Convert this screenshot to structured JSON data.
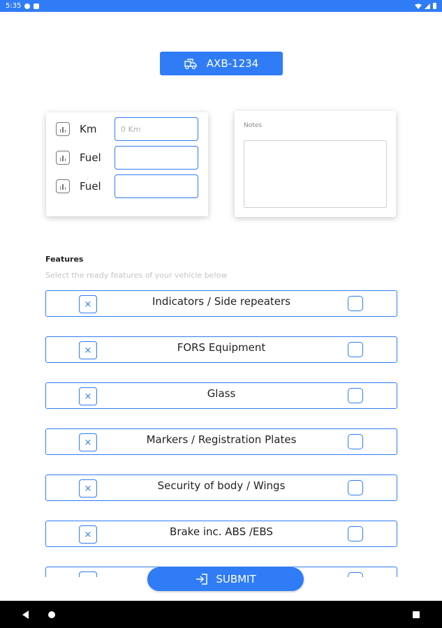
{
  "status_bar": {
    "time": "5:35"
  },
  "vehicle": {
    "registration": "AXB-1234",
    "icon": "truck-icon"
  },
  "readings": [
    {
      "label": "Km",
      "placeholder": "0 Km",
      "value": ""
    },
    {
      "label": "Fuel",
      "placeholder": "",
      "value": ""
    },
    {
      "label": "Fuel",
      "placeholder": "",
      "value": ""
    }
  ],
  "notes": {
    "label": "Notes",
    "value": ""
  },
  "features": {
    "title": "Features",
    "subtitle": "Select the ready features of your vehicle below",
    "items": [
      {
        "label": "Indicators / Side repeaters",
        "checked": false
      },
      {
        "label": "FORS Equipment",
        "checked": false
      },
      {
        "label": "Glass",
        "checked": false
      },
      {
        "label": "Markers / Registration Plates",
        "checked": false
      },
      {
        "label": "Security of body / Wings",
        "checked": false
      },
      {
        "label": "Brake inc. ABS /EBS",
        "checked": false
      },
      {
        "label": "",
        "checked": false
      }
    ],
    "remove_glyph": "×"
  },
  "submit": {
    "label": "SUBMIT",
    "icon": "login-icon"
  },
  "colors": {
    "accent": "#2f7cf6",
    "navbar": "#000000"
  }
}
